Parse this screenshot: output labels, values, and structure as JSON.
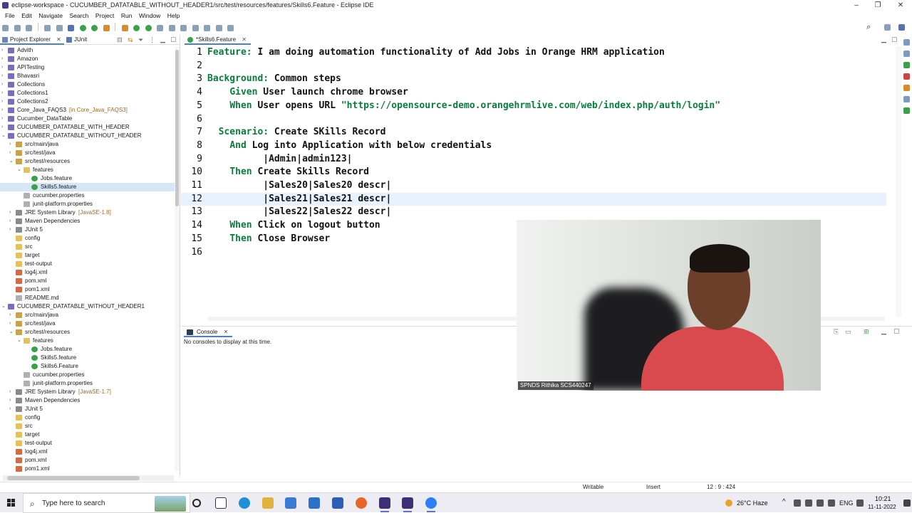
{
  "window": {
    "title": "eclipse-workspace - CUCUMBER_DATATABLE_WITHOUT_HEADER1/src/test/resources/features/Skills6.Feature - Eclipse IDE"
  },
  "menu": [
    "File",
    "Edit",
    "Navigate",
    "Search",
    "Project",
    "Run",
    "Window",
    "Help"
  ],
  "left_panel": {
    "tabs": [
      {
        "label": "Project Explorer"
      },
      {
        "label": "JUnit"
      }
    ],
    "tree": [
      {
        "label": "Advith",
        "icon": "project-icon",
        "level": 0,
        "twist": ">"
      },
      {
        "label": "Amazon",
        "icon": "project-icon",
        "level": 0,
        "twist": ">"
      },
      {
        "label": "APITesting",
        "icon": "project-icon",
        "level": 0,
        "twist": ">"
      },
      {
        "label": "Bhavasri",
        "icon": "project-icon",
        "level": 0,
        "twist": ">"
      },
      {
        "label": "Collections",
        "icon": "project-icon",
        "level": 0,
        "twist": ">"
      },
      {
        "label": "Collections1",
        "icon": "project-icon",
        "level": 0,
        "twist": ">"
      },
      {
        "label": "Collections2",
        "icon": "project-icon",
        "level": 0,
        "twist": ">"
      },
      {
        "label": "Core_Java_FAQS3",
        "decoration": "[in Core_Java_FAQS3]",
        "icon": "project-icon",
        "level": 0,
        "twist": ">"
      },
      {
        "label": "Cucumber_DataTable",
        "icon": "project-icon",
        "level": 0,
        "twist": ">"
      },
      {
        "label": "CUCUMBER_DATATABLE_WITH_HEADER",
        "icon": "project-icon",
        "level": 0,
        "twist": ">"
      },
      {
        "label": "CUCUMBER_DATATABLE_WITHOUT_HEADER",
        "icon": "project-icon",
        "level": 0,
        "twist": "v"
      },
      {
        "label": "src/main/java",
        "icon": "source-folder-icon",
        "level": 1,
        "twist": ">"
      },
      {
        "label": "src/test/java",
        "icon": "source-folder-icon",
        "level": 1,
        "twist": ">"
      },
      {
        "label": "src/test/resources",
        "icon": "source-folder-icon",
        "level": 1,
        "twist": "v"
      },
      {
        "label": "features",
        "icon": "folder-icon",
        "level": 2,
        "twist": "v"
      },
      {
        "label": "Jobs.feature",
        "icon": "feature-file-icon",
        "level": 3,
        "twist": ""
      },
      {
        "label": "Skills5.feature",
        "icon": "feature-file-icon",
        "level": 3,
        "twist": "",
        "selected": true
      },
      {
        "label": "cucumber.properties",
        "icon": "file-icon",
        "level": 2,
        "twist": ""
      },
      {
        "label": "junit-platform.properties",
        "icon": "file-icon",
        "level": 2,
        "twist": ""
      },
      {
        "label": "JRE System Library",
        "decoration": "[JavaSE-1.8]",
        "icon": "library-icon",
        "level": 1,
        "twist": ">"
      },
      {
        "label": "Maven Dependencies",
        "icon": "library-icon",
        "level": 1,
        "twist": ">"
      },
      {
        "label": "JUnit 5",
        "icon": "library-icon",
        "level": 1,
        "twist": ">"
      },
      {
        "label": "config",
        "icon": "folder-icon",
        "level": 1,
        "twist": ""
      },
      {
        "label": "src",
        "icon": "folder-icon",
        "level": 1,
        "twist": ""
      },
      {
        "label": "target",
        "icon": "folder-icon",
        "level": 1,
        "twist": ""
      },
      {
        "label": "test-output",
        "icon": "folder-icon",
        "level": 1,
        "twist": ""
      },
      {
        "label": "log4j.xml",
        "icon": "xml-file-icon",
        "level": 1,
        "twist": ""
      },
      {
        "label": "pom.xml",
        "icon": "xml-file-icon",
        "level": 1,
        "twist": ""
      },
      {
        "label": "pom1.xml",
        "icon": "xml-file-icon",
        "level": 1,
        "twist": ""
      },
      {
        "label": "README.md",
        "icon": "file-icon",
        "level": 1,
        "twist": ""
      },
      {
        "label": "CUCUMBER_DATATABLE_WITHOUT_HEADER1",
        "icon": "project-icon",
        "level": 0,
        "twist": "v"
      },
      {
        "label": "src/main/java",
        "icon": "source-folder-icon",
        "level": 1,
        "twist": ">"
      },
      {
        "label": "src/test/java",
        "icon": "source-folder-icon",
        "level": 1,
        "twist": ">"
      },
      {
        "label": "src/test/resources",
        "icon": "source-folder-icon",
        "level": 1,
        "twist": "v"
      },
      {
        "label": "features",
        "icon": "folder-icon",
        "level": 2,
        "twist": "v"
      },
      {
        "label": "Jobs.feature",
        "icon": "feature-file-icon",
        "level": 3,
        "twist": ""
      },
      {
        "label": "Skills5.feature",
        "icon": "feature-file-icon",
        "level": 3,
        "twist": ""
      },
      {
        "label": "Skills6.Feature",
        "icon": "feature-file-icon",
        "level": 3,
        "twist": ""
      },
      {
        "label": "cucumber.properties",
        "icon": "file-icon",
        "level": 2,
        "twist": ""
      },
      {
        "label": "junit-platform.properties",
        "icon": "file-icon",
        "level": 2,
        "twist": ""
      },
      {
        "label": "JRE System Library",
        "decoration": "[JavaSE-1.7]",
        "icon": "library-icon",
        "level": 1,
        "twist": ">"
      },
      {
        "label": "Maven Dependencies",
        "icon": "library-icon",
        "level": 1,
        "twist": ">"
      },
      {
        "label": "JUnit 5",
        "icon": "library-icon",
        "level": 1,
        "twist": ">"
      },
      {
        "label": "config",
        "icon": "folder-icon",
        "level": 1,
        "twist": ""
      },
      {
        "label": "src",
        "icon": "folder-icon",
        "level": 1,
        "twist": ""
      },
      {
        "label": "target",
        "icon": "folder-icon",
        "level": 1,
        "twist": ""
      },
      {
        "label": "test-output",
        "icon": "folder-icon",
        "level": 1,
        "twist": ""
      },
      {
        "label": "log4j.xml",
        "icon": "xml-file-icon",
        "level": 1,
        "twist": ""
      },
      {
        "label": "pom.xml",
        "icon": "xml-file-icon",
        "level": 1,
        "twist": ""
      },
      {
        "label": "pom1.xml",
        "icon": "xml-file-icon",
        "level": 1,
        "twist": ""
      }
    ]
  },
  "editor": {
    "tab_label": "*Skills6.Feature",
    "current_line": 12,
    "lines": [
      {
        "n": "1",
        "kw": "Feature:",
        "rest": " I am doing automation functionality of Add Jobs in Orange HRM application",
        "indent": ""
      },
      {
        "n": "2",
        "kw": "",
        "rest": "",
        "indent": ""
      },
      {
        "n": "3",
        "kw": "Background:",
        "rest": " Common steps",
        "indent": ""
      },
      {
        "n": "4",
        "kw": "Given",
        "rest": " User launch chrome browser",
        "indent": "    "
      },
      {
        "n": "5",
        "kw": "When",
        "rest": " User opens URL ",
        "str": "\"https://opensource-demo.orangehrmlive.com/web/index.php/auth/login\"",
        "indent": "    "
      },
      {
        "n": "6",
        "kw": "",
        "rest": "",
        "indent": ""
      },
      {
        "n": "7",
        "kw": "Scenario:",
        "rest": " Create SKills Record",
        "indent": "  "
      },
      {
        "n": "8",
        "kw": "And",
        "rest": " Log into Application with below credentials",
        "indent": "    "
      },
      {
        "n": "9",
        "kw": "",
        "rest": "|Admin|admin123|",
        "indent": "          "
      },
      {
        "n": "10",
        "kw": "Then",
        "rest": " Create Skills Record",
        "indent": "    "
      },
      {
        "n": "11",
        "kw": "",
        "rest": "|Sales20|Sales20 descr|",
        "indent": "          "
      },
      {
        "n": "12",
        "kw": "",
        "rest": "|Sales21|Sales21 descr|",
        "indent": "          "
      },
      {
        "n": "13",
        "kw": "",
        "rest": "|Sales22|Sales22 descr|",
        "indent": "          "
      },
      {
        "n": "14",
        "kw": "When",
        "rest": " Click on logout button",
        "indent": "    "
      },
      {
        "n": "15",
        "kw": "Then",
        "rest": " Close Browser",
        "indent": "    "
      },
      {
        "n": "16",
        "kw": "",
        "rest": "",
        "indent": ""
      }
    ]
  },
  "console": {
    "tab_label": "Console",
    "message": "No consoles to display at this time."
  },
  "video": {
    "label": "SPNDS Rithika SCS440247"
  },
  "statusbar": {
    "writable": "Writable",
    "insert": "Insert",
    "position": "12 : 9 : 424"
  },
  "taskbar": {
    "search_placeholder": "Type here to search",
    "weather": "26°C  Haze",
    "lang": "ENG",
    "time": "10:21",
    "date": "11-11-2022"
  },
  "colors": {
    "keyword": "#0a7d3c",
    "selection": "#d5e6f7",
    "current_line": "#e8f2fe",
    "accent": "#4a80c8"
  }
}
